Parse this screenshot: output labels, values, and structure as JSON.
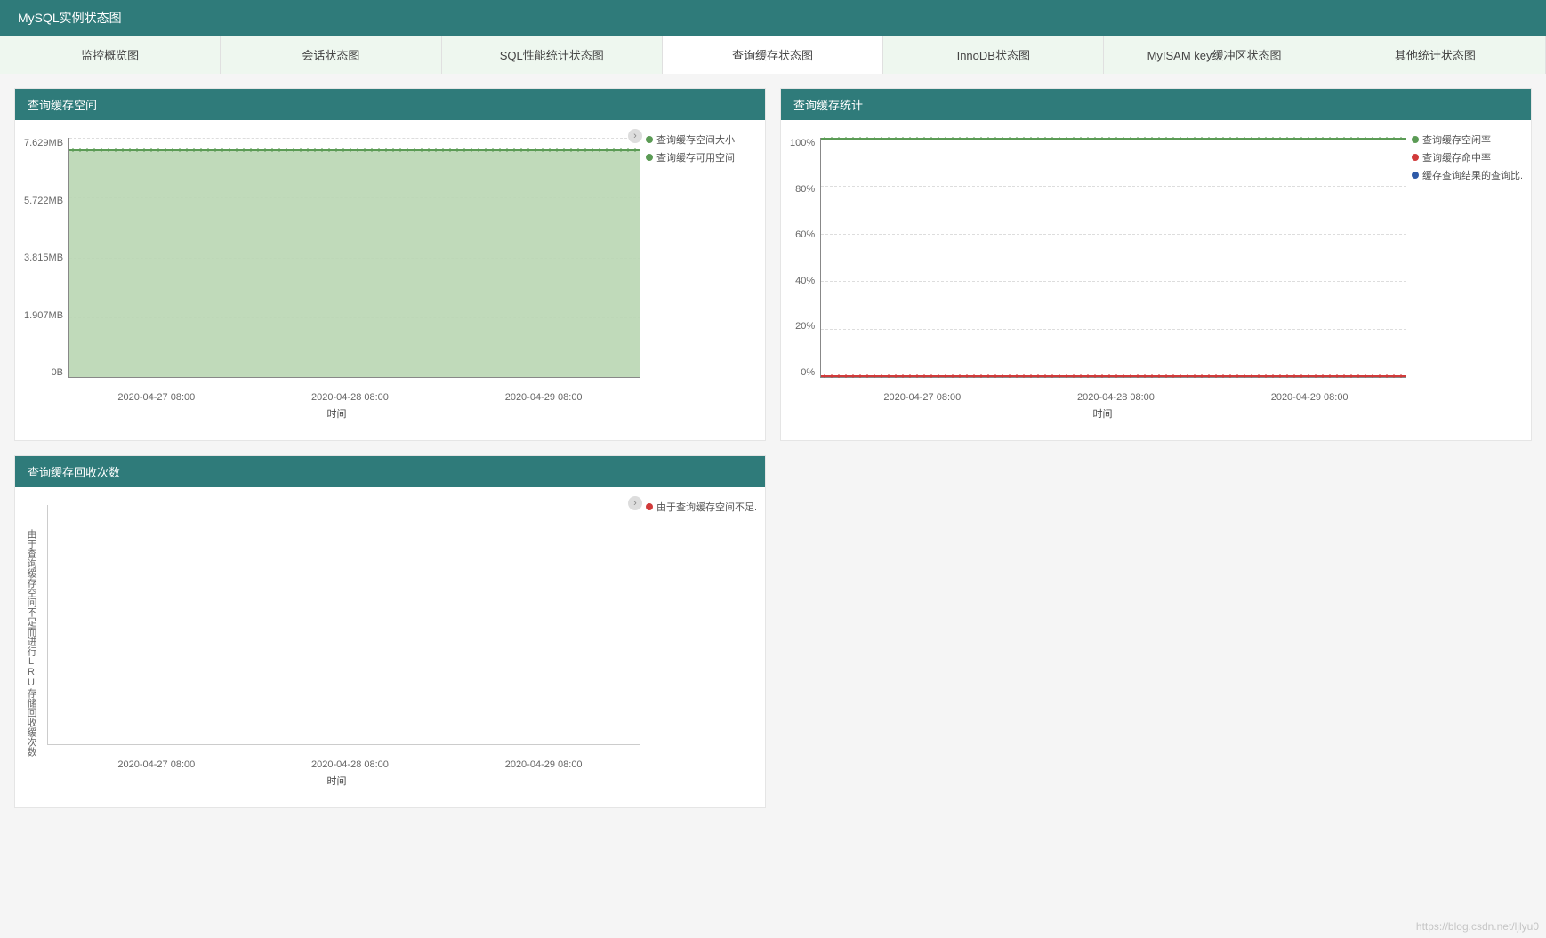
{
  "header": {
    "title": "MySQL实例状态图"
  },
  "tabs": [
    {
      "label": "监控概览图",
      "active": false
    },
    {
      "label": "会话状态图",
      "active": false
    },
    {
      "label": "SQL性能统计状态图",
      "active": false
    },
    {
      "label": "查询缓存状态图",
      "active": true
    },
    {
      "label": "InnoDB状态图",
      "active": false
    },
    {
      "label": "MyISAM key缓冲区状态图",
      "active": false
    },
    {
      "label": "其他统计状态图",
      "active": false
    }
  ],
  "panels": {
    "space": {
      "title": "查询缓存空间",
      "xlabel": "时间",
      "y_ticks": [
        "7.629MB",
        "5.722MB",
        "3.815MB",
        "1.907MB",
        "0B"
      ],
      "x_ticks": [
        "2020-04-27 08:00",
        "2020-04-28 08:00",
        "2020-04-29 08:00"
      ],
      "legend": [
        {
          "label": "查询缓存空间大小",
          "color": "#5b9b55"
        },
        {
          "label": "查询缓存可用空间",
          "color": "#5b9b55"
        }
      ],
      "expand_icon": "›"
    },
    "stats": {
      "title": "查询缓存统计",
      "xlabel": "时间",
      "y_ticks": [
        "100%",
        "80%",
        "60%",
        "40%",
        "20%",
        "0%"
      ],
      "x_ticks": [
        "2020-04-27 08:00",
        "2020-04-28 08:00",
        "2020-04-29 08:00"
      ],
      "legend": [
        {
          "label": "查询缓存空闲率",
          "color": "#5b9b55"
        },
        {
          "label": "查询缓存命中率",
          "color": "#d13a3a"
        },
        {
          "label": "缓存查询结果的查询比...",
          "color": "#2e5aa8"
        }
      ]
    },
    "recycle": {
      "title": "查询缓存回收次数",
      "xlabel": "时间",
      "ylabel": "由于查询缓存空间不足而进行LRU存储回收缓次数",
      "x_ticks": [
        "2020-04-27 08:00",
        "2020-04-28 08:00",
        "2020-04-29 08:00"
      ],
      "legend": [
        {
          "label": "由于查询缓存空间不足...",
          "color": "#d13a3a"
        }
      ],
      "expand_icon": "›"
    }
  },
  "watermark": "https://blog.csdn.net/ljlyu0",
  "chart_data": [
    {
      "type": "area",
      "title": "查询缓存空间",
      "xlabel": "时间",
      "ylabel": "",
      "x": [
        "2020-04-27 08:00",
        "2020-04-28 08:00",
        "2020-04-29 08:00"
      ],
      "series": [
        {
          "name": "查询缓存空间大小",
          "values": [
            8000000,
            8000000,
            8000000
          ],
          "unit": "bytes"
        },
        {
          "name": "查询缓存可用空间",
          "values": [
            8000000,
            8000000,
            8000000
          ],
          "unit": "bytes"
        }
      ],
      "ylim_bytes": [
        0,
        8000000
      ],
      "y_tick_labels": [
        "0B",
        "1.907MB",
        "3.815MB",
        "5.722MB",
        "7.629MB"
      ]
    },
    {
      "type": "line",
      "title": "查询缓存统计",
      "xlabel": "时间",
      "ylabel": "",
      "x": [
        "2020-04-27 08:00",
        "2020-04-28 08:00",
        "2020-04-29 08:00"
      ],
      "series": [
        {
          "name": "查询缓存空闲率",
          "values": [
            100,
            100,
            100
          ],
          "unit": "%"
        },
        {
          "name": "查询缓存命中率",
          "values": [
            0,
            0,
            0
          ],
          "unit": "%"
        },
        {
          "name": "缓存查询结果的查询比",
          "values": [
            0,
            0,
            0
          ],
          "unit": "%"
        }
      ],
      "ylim": [
        0,
        100
      ]
    },
    {
      "type": "line",
      "title": "查询缓存回收次数",
      "xlabel": "时间",
      "ylabel": "由于查询缓存空间不足而进行LRU存储回收缓次数",
      "x": [
        "2020-04-27 08:00",
        "2020-04-28 08:00",
        "2020-04-29 08:00"
      ],
      "series": [
        {
          "name": "由于查询缓存空间不足而进行LRU回收次数",
          "values": [
            0,
            0,
            0
          ]
        }
      ]
    }
  ]
}
